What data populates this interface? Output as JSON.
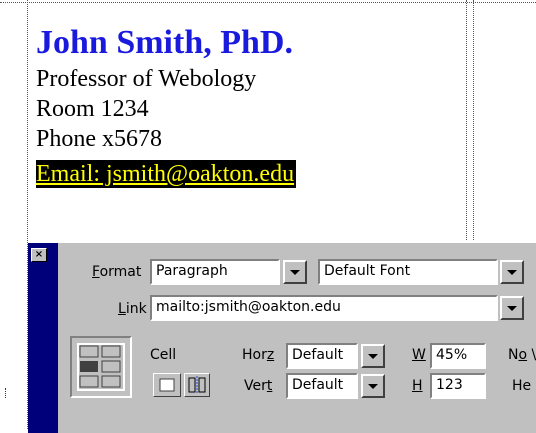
{
  "document": {
    "name": "John Smith, PhD.",
    "title": "Professor of Webology",
    "room": "Room 1234",
    "phone": "Phone x5678",
    "email": "Email: jsmith@oakton.edu"
  },
  "inspector": {
    "close_label": "×",
    "format_label_key": "F",
    "format_label_rest": "ormat",
    "format_value": "Paragraph",
    "font_value": "Default Font",
    "link_label_key": "L",
    "link_label_rest": "ink",
    "link_value": "mailto:jsmith@oakton.edu",
    "cell_label": "Cell",
    "horz_label_pre": "Hor",
    "horz_label_key": "z",
    "horz_value": "Default",
    "vert_label_pre": "Ver",
    "vert_label_key": "t",
    "vert_value": "Default",
    "w_label_key": "W",
    "w_value": "45%",
    "h_label_key": "H",
    "h_value": "123",
    "nowrap_label_pre": "N",
    "nowrap_label_key": "o",
    "nowrap_label_rest": " \\",
    "header_label": "He"
  },
  "icons": [
    "table-cell-icon",
    "merge-cells-icon",
    "split-cells-icon",
    "close-icon",
    "dropdown-arrow-icon"
  ]
}
